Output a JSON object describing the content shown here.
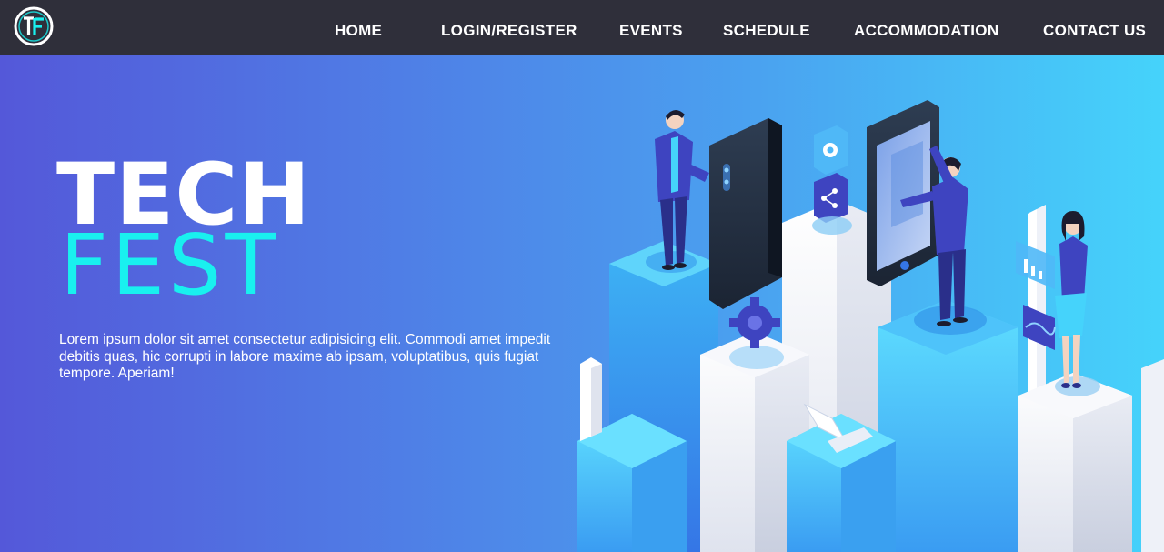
{
  "brand": {
    "logo_icon": "tf-monogram-logo",
    "logo_text": "TF"
  },
  "nav": {
    "items": [
      {
        "label": "HOME"
      },
      {
        "label": "LOGIN/REGISTER"
      },
      {
        "label": "EVENTS"
      },
      {
        "label": "SCHEDULE"
      },
      {
        "label": "ACCOMMODATION"
      },
      {
        "label": "CONTACT US"
      }
    ]
  },
  "hero": {
    "title_line1": "TECH",
    "title_line2": "FEST",
    "description": "Lorem ipsum dolor sit amet consectetur adipisicing elit. Commodi amet impedit debitis quas, hic corrupti in labore maxime ab ipsam, voluptatibus, quis fugiat tempore. Aperiam!",
    "illustration": "isometric-technology-illustration"
  },
  "colors": {
    "nav_bg": "#2f2f3a",
    "hero_gradient_start": "#5458d9",
    "hero_gradient_end": "#45d3fb",
    "accent": "#19f0ef",
    "text": "#ffffff"
  }
}
